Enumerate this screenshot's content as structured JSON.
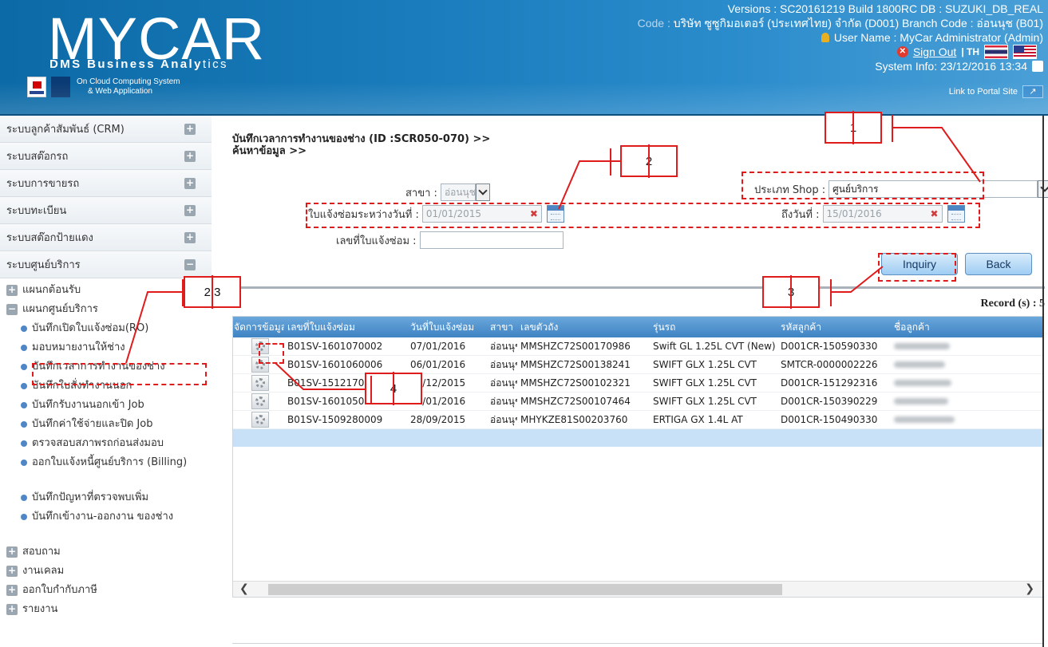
{
  "header": {
    "logo": "MYCAR",
    "tagline_bold": "DMS Business Analy",
    "tagline_light": "tics",
    "cloud_line1": "On Cloud Computing System",
    "cloud_line2": "& Web Application",
    "versions": "Versions : SC20161219 Build 1800RC DB : SUZUKI_DB_REAL",
    "company_prefix": "Code : ",
    "company": "บริษัท ซูซูกิมอเตอร์ (ประเทศไทย) จำกัด (D001)  Branch Code : อ่อนนุช (B01)",
    "user": "User Name : MyCar Administrator  (Admin)",
    "sign_out": "Sign Out",
    "lang": "| TH",
    "system_info": "System Info: 23/12/2016 13:34",
    "portal_link": "Link to Portal Site"
  },
  "sidebar": {
    "sections": [
      {
        "label": "ระบบลูกค้าสัมพันธ์ (CRM)",
        "toggle": "+"
      },
      {
        "label": "ระบบสต๊อกรถ",
        "toggle": "+"
      },
      {
        "label": "ระบบการขายรถ",
        "toggle": "+"
      },
      {
        "label": "ระบบทะเบียน",
        "toggle": "+"
      },
      {
        "label": "ระบบสต๊อกป้ายแดง",
        "toggle": "+"
      },
      {
        "label": "ระบบศูนย์บริการ",
        "toggle": "−"
      }
    ],
    "tree": {
      "reception": "แผนกต้อนรับ",
      "service": "แผนกศูนย์บริการ",
      "items": [
        "บันทึกเปิดใบแจ้งซ่อม(RO)",
        "มอบหมายงานให้ช่าง",
        "บันทึกเวลาการทำงานของช่าง",
        "บันทึกใบสั่งทำงานนอก",
        "บันทึกรับงานนอกเข้า Job",
        "บันทึกค่าใช้จ่ายและปิด Job",
        "ตรวจสอบสภาพรถก่อนส่งมอบ",
        "ออกใบแจ้งหนี้ศูนย์บริการ (Billing)",
        "บันทึกปัญหาที่ตรวจพบเพิ่ม",
        "บันทึกเข้างาน-ออกงาน ของช่าง"
      ],
      "inquiry": "สอบถาม",
      "claims": "งานเคลม",
      "tax_invoice": "ออกใบกำกับภาษี",
      "reports": "รายงาน"
    }
  },
  "main": {
    "title_line1": "บันทึกเวลาการทำงานของช่าง (ID :SCR050-070) >>",
    "title_line2": "ค้นหาข้อมูล >>",
    "branch_label": "สาขา :",
    "branch_value": "อ่อนนุช",
    "shop_type_label": "ประเภท Shop :",
    "shop_type_value": "ศูนย์บริการ",
    "date_from_label": "ใบแจ้งซ่อมระหว่างวันที่ :",
    "date_from_value": "01/01/2015",
    "date_to_label": "ถึงวันที่ :",
    "date_to_value": "15/01/2016",
    "ro_number_label": "เลขที่ใบแจ้งซ่อม :",
    "ro_number_value": "",
    "inquiry_button": "Inquiry",
    "back_button": "Back",
    "record_count": "Record (s) : 5"
  },
  "table": {
    "columns": [
      "จัดการข้อมูล",
      "เลขที่ใบแจ้งซ่อม",
      "วันที่ใบแจ้งซ่อม",
      "สาขา",
      "เลขตัวถัง",
      "รุ่นรถ",
      "รหัสลูกค้า",
      "ชื่อลูกค้า"
    ],
    "rows": [
      {
        "ro": "B01SV-1601070002",
        "date": "07/01/2016",
        "branch": "อ่อนนุช",
        "chassis": "MMSHZC72S00170986",
        "model": "Swift GL 1.25L CVT (New)",
        "customer_code": "D001CR-150590330"
      },
      {
        "ro": "B01SV-1601060006",
        "date": "06/01/2016",
        "branch": "อ่อนนุช",
        "chassis": "MMSHZC72S00138241",
        "model": "SWIFT GLX 1.25L CVT",
        "customer_code": "SMTCR-0000002226"
      },
      {
        "ro": "B01SV-1512170008",
        "date": "17/12/2015",
        "branch": "อ่อนนุช",
        "chassis": "MMSHZC72S00102321",
        "model": "SWIFT GLX 1.25L CVT",
        "customer_code": "D001CR-151292316"
      },
      {
        "ro": "B01SV-1601050001",
        "date": "05/01/2016",
        "branch": "อ่อนนุช",
        "chassis": "MMSHZC72S00107464",
        "model": "SWIFT GLX 1.25L CVT",
        "customer_code": "D001CR-150390229"
      },
      {
        "ro": "B01SV-1509280009",
        "date": "28/09/2015",
        "branch": "อ่อนนุช",
        "chassis": "MHYKZE81S00203760",
        "model": "ERTIGA GX 1.4L AT",
        "customer_code": "D001CR-150490330"
      }
    ]
  },
  "annotations": {
    "c1": "1",
    "c2": "2",
    "c3": "3",
    "c4": "4",
    "c23": "2.3"
  },
  "colors": {
    "header_blue": "#1a7cbc",
    "annotation_red": "#e01b1b",
    "grid_header": "#3f83c3",
    "selected_row": "#c8e1f7"
  }
}
